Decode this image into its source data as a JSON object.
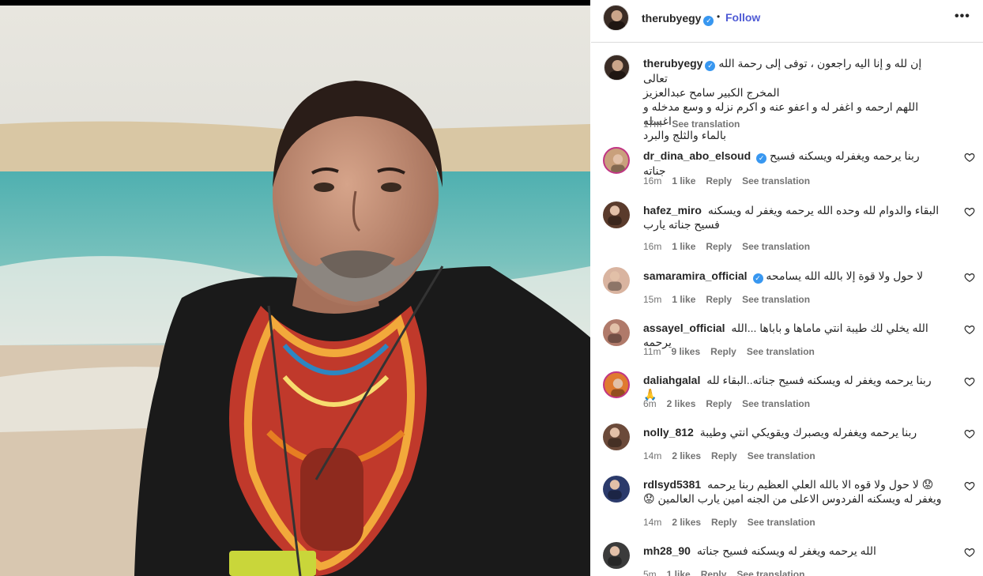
{
  "post": {
    "username": "therubyegy",
    "follow_label": "Follow",
    "more_label": "•••",
    "dot": "•",
    "caption_lines": [
      "إن لله و إنا اليه راجعون ، توفى إلى رحمة الله تعالى",
      "المخرج الكبير سامح عبدالعزيز",
      "اللهم ارحمه و اغفر له و اعفو عنه و اكرم نزله و وسع مدخله و اغسله",
      "بالماء والثلج والبرد"
    ],
    "time": "17m",
    "see_translation": "See translation"
  },
  "comments": [
    {
      "username": "dr_dina_abo_elsoud",
      "verified": true,
      "text": "ربنا يرحمه ويغفرله ويسكنه فسيح جناته",
      "time": "16m",
      "likes": "1 like",
      "reply": "Reply",
      "see_translation": "See translation",
      "avatar_color": "#c9a07c",
      "ring": true
    },
    {
      "username": "hafez_miro",
      "verified": false,
      "text": "البقاء والدوام لله وحده الله يرحمه ويغفر له ويسكنه فسيح جناته يارب",
      "time": "16m",
      "likes": "1 like",
      "reply": "Reply",
      "see_translation": "See translation",
      "avatar_color": "#5a3b2c",
      "ring": false
    },
    {
      "username": "samaramira_official",
      "verified": true,
      "text": "لا حول ولا قوة إلا بالله الله يسامحه",
      "time": "15m",
      "likes": "1 like",
      "reply": "Reply",
      "see_translation": "See translation",
      "avatar_color": "#d9b4a0",
      "ring": false
    },
    {
      "username": "assayel_official",
      "verified": false,
      "text": "الله يخلي لك طيبة انتي ماماها و باباها ...الله يرحمه",
      "time": "11m",
      "likes": "9 likes",
      "reply": "Reply",
      "see_translation": "See translation",
      "avatar_color": "#b07a6a",
      "ring": false
    },
    {
      "username": "daliahgalal",
      "verified": false,
      "text": "ربنا يرحمه ويغفر له ويسكنه فسيح جناته..البقاء لله 🙏",
      "time": "6m",
      "likes": "2 likes",
      "reply": "Reply",
      "see_translation": "See translation",
      "avatar_color": "#e07a30",
      "ring": true
    },
    {
      "username": "nolly_812",
      "verified": false,
      "text": "ربنا يرحمه ويغفرله ويصبرك ويقويكي انتي وطيبة",
      "time": "14m",
      "likes": "2 likes",
      "reply": "Reply",
      "see_translation": "See translation",
      "avatar_color": "#6b4a3a",
      "ring": false
    },
    {
      "username": "rdlsyd5381",
      "verified": false,
      "text": "😟 لا حول ولا قوه الا بالله العلي العظيم ربنا يرحمه ويغفر له ويسكنه الفردوس الاعلى من الجنه امين يارب العالمين 😟",
      "time": "14m",
      "likes": "2 likes",
      "reply": "Reply",
      "see_translation": "See translation",
      "avatar_color": "#2b3a6b",
      "ring": false
    },
    {
      "username": "mh28_90",
      "verified": false,
      "text": "الله يرحمه ويغفر له ويسكنه فسيح جناته",
      "time": "5m",
      "likes": "1 like",
      "reply": "Reply",
      "see_translation": "See translation",
      "avatar_color": "#3b3b3b",
      "ring": false
    }
  ],
  "colors": {
    "follow": "#4f5bd5",
    "verified": "#3897f0",
    "muted": "#737373",
    "border": "#dbdbdb"
  },
  "icons": {
    "verified": "verified-badge-icon",
    "like": "heart-icon",
    "more": "more-options-icon"
  }
}
